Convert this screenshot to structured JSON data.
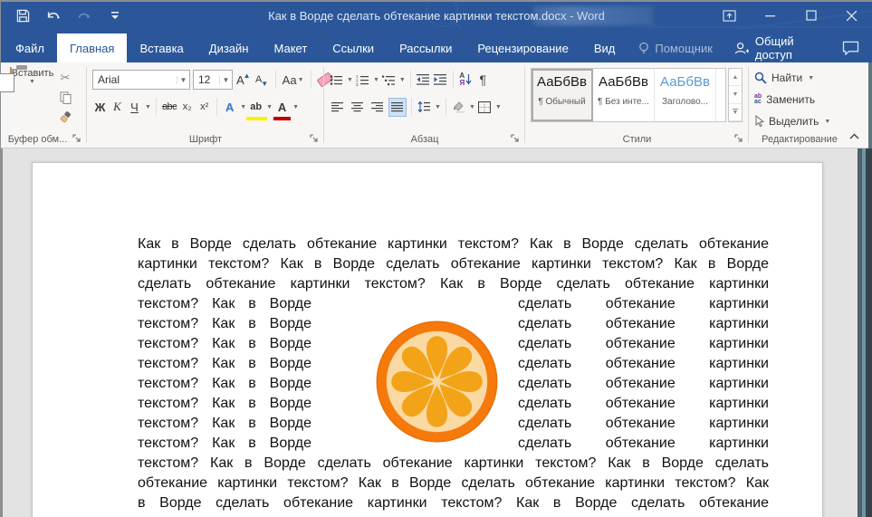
{
  "window": {
    "title": "Как в Ворде сделать обтекание картинки текстом.docx - Word"
  },
  "tabs": {
    "file": "Файл",
    "items": [
      {
        "label": "Главная",
        "active": true
      },
      {
        "label": "Вставка",
        "active": false
      },
      {
        "label": "Дизайн",
        "active": false
      },
      {
        "label": "Макет",
        "active": false
      },
      {
        "label": "Ссылки",
        "active": false
      },
      {
        "label": "Рассылки",
        "active": false
      },
      {
        "label": "Рецензирование",
        "active": false
      },
      {
        "label": "Вид",
        "active": false
      }
    ],
    "assistant": "Помощник",
    "share": "Общий доступ"
  },
  "ribbon": {
    "clipboard": {
      "paste_label": "Вставить",
      "group_label": "Буфер обм..."
    },
    "font": {
      "name": "Arial",
      "size": "12",
      "grow": "А",
      "shrink": "А",
      "change_case": "Аа",
      "bold": "Ж",
      "italic": "К",
      "underline": "Ч",
      "strikethrough": "abc",
      "subscript": "x₂",
      "superscript": "x²",
      "text_effects": "А",
      "highlight": "ab",
      "font_color": "А",
      "group_label": "Шрифт"
    },
    "paragraph": {
      "sort_top": "А",
      "sort_bottom": "Я",
      "pilcrow": "¶",
      "group_label": "Абзац"
    },
    "styles": {
      "group_label": "Стили",
      "items": [
        {
          "sample": "АаБбВв",
          "name": "¶ Обычный",
          "selected": true
        },
        {
          "sample": "АаБбВв",
          "name": "¶ Без инте...",
          "selected": false
        },
        {
          "sample": "АаБбВв",
          "name": "Заголово...",
          "selected": false
        }
      ]
    },
    "editing": {
      "find": "Найти",
      "replace": "Заменить",
      "select": "Выделить",
      "group_label": "Редактирование"
    }
  },
  "document": {
    "top_lines": [
      "Как в Ворде сделать обтекание картинки текстом? Как в Ворде сделать обтекание",
      "картинки текстом? Как в Ворде сделать обтекание картинки текстом? Как в Ворде",
      "сделать обтекание картинки текстом? Как в Ворде сделать обтекание картинки"
    ],
    "wrap_left": "текстом? Как в Ворде",
    "wrap_right": "сделать обтекание картинки",
    "bottom_lines": [
      "текстом? Как в Ворде сделать обтекание картинки текстом? Как в Ворде сделать",
      "обтекание картинки текстом? Как в Ворде сделать обтекание картинки текстом? Как",
      "в Ворде сделать обтекание картинки текстом? Как в Ворде сделать обтекание"
    ]
  },
  "colors": {
    "titlebar": "#2B579A",
    "orange_rim": "#F5790B",
    "orange_flesh": "#FBD9A2",
    "orange_segment": "#F2A318"
  }
}
